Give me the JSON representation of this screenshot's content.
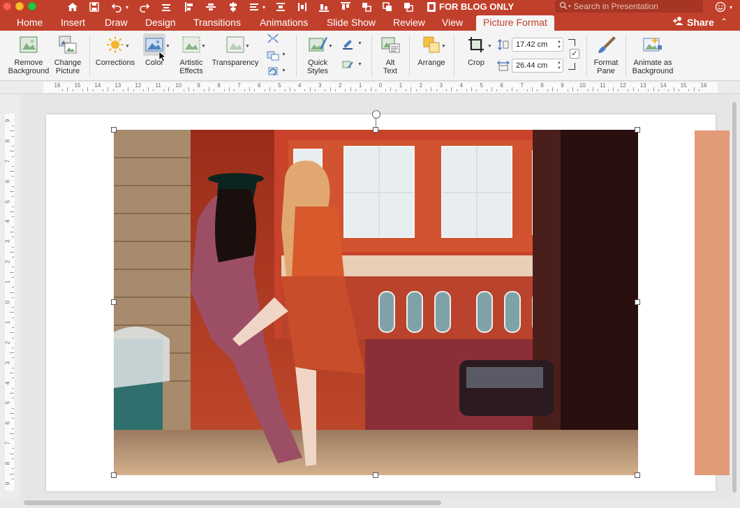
{
  "window": {
    "document_title": "FOR BLOG ONLY",
    "search_placeholder": "Search in Presentation"
  },
  "tabs": [
    {
      "label": "Home"
    },
    {
      "label": "Insert"
    },
    {
      "label": "Draw"
    },
    {
      "label": "Design"
    },
    {
      "label": "Transitions"
    },
    {
      "label": "Animations"
    },
    {
      "label": "Slide Show"
    },
    {
      "label": "Review"
    },
    {
      "label": "View"
    },
    {
      "label": "Picture Format",
      "active": true
    }
  ],
  "share_label": "Share",
  "ribbon": {
    "remove_background": [
      "Remove",
      "Background"
    ],
    "change_picture": [
      "Change",
      "Picture"
    ],
    "corrections": "Corrections",
    "color": "Color",
    "artistic_effects": [
      "Artistic",
      "Effects"
    ],
    "transparency": "Transparency",
    "quick_styles": [
      "Quick",
      "Styles"
    ],
    "alt_text": [
      "Alt",
      "Text"
    ],
    "arrange": "Arrange",
    "crop": "Crop",
    "height_value": "17.42 cm",
    "width_value": "26.44 cm",
    "format_pane": [
      "Format",
      "Pane"
    ],
    "animate_as_background": [
      "Animate as",
      "Background"
    ]
  },
  "ruler": {
    "horizontal_labels": [
      "16",
      "15",
      "14",
      "13",
      "12",
      "11",
      "10",
      "9",
      "8",
      "7",
      "6",
      "5",
      "4",
      "3",
      "2",
      "1",
      "0",
      "1",
      "2",
      "3",
      "4",
      "5",
      "6",
      "7",
      "8",
      "9",
      "10",
      "11",
      "12",
      "13",
      "14",
      "15",
      "16"
    ],
    "vertical_labels": [
      "9",
      "8",
      "7",
      "6",
      "5",
      "4",
      "3",
      "2",
      "1",
      "0",
      "1",
      "2",
      "3",
      "4",
      "5",
      "6",
      "7",
      "8",
      "9"
    ]
  },
  "colors": {
    "accent": "#c1402c",
    "ribbon_bg": "#f4f4f4",
    "peach_shape": "#e29a78"
  },
  "icons": {
    "home": "home-icon",
    "save": "save-icon",
    "undo": "undo-icon",
    "redo": "redo-icon",
    "search": "search-icon",
    "smiley": "smiley-icon"
  }
}
